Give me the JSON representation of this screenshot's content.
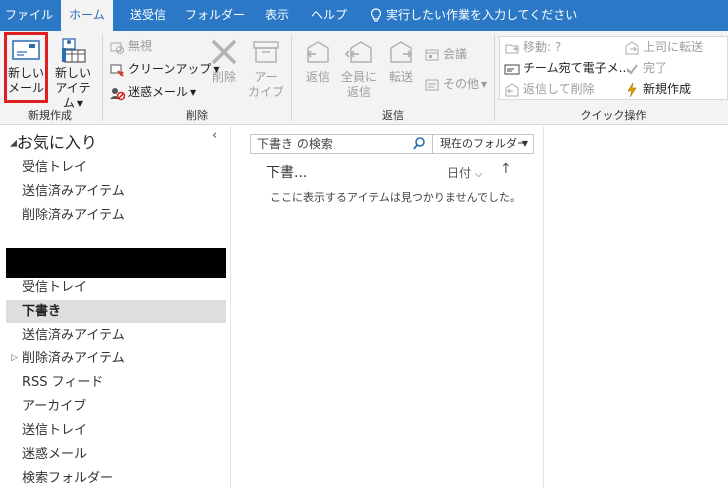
{
  "menubar": {
    "tabs": [
      "ファイル",
      "ホーム",
      "送受信",
      "フォルダー",
      "表示",
      "ヘルプ"
    ],
    "tell_me": "実行したい作業を入力してください"
  },
  "ribbon": {
    "new_group": {
      "label": "新規作成",
      "new_mail_line1": "新しい",
      "new_mail_line2": "メール",
      "new_items_line1": "新しい",
      "new_items_line2": "アイテム"
    },
    "delete_group": {
      "label": "削除",
      "ignore": "無視",
      "cleanup": "クリーンアップ",
      "junk": "迷惑メール",
      "delete": "削除",
      "archive_line1": "アー",
      "archive_line2": "カイブ"
    },
    "respond_group": {
      "label": "返信",
      "reply": "返信",
      "reply_all_line1": "全員に",
      "reply_all_line2": "返信",
      "forward": "転送",
      "meeting": "会議",
      "more": "その他"
    },
    "quicksteps_group": {
      "label": "クイック操作",
      "move_to": "移動: ?",
      "team_email": "チーム宛て電子メ...",
      "reply_delete": "返信して削除",
      "to_manager": "上司に転送",
      "done": "完了",
      "create_new": "新規作成"
    }
  },
  "folderpane": {
    "favorites_header": "お気に入り",
    "favorites": [
      "受信トレイ",
      "送信済みアイテム",
      "削除済みアイテム"
    ],
    "folders": [
      "受信トレイ",
      "下書き",
      "送信済みアイテム",
      "削除済みアイテム",
      "RSS フィード",
      "アーカイブ",
      "送信トレイ",
      "迷惑メール",
      "検索フォルダー"
    ]
  },
  "msglist": {
    "search_placeholder": "下書き の検索",
    "scope": "現在のフォルダー",
    "title": "下書...",
    "sort_by": "日付",
    "empty_message": "ここに表示するアイテムは見つかりませんでした。"
  },
  "colors": {
    "accent": "#2b78c6",
    "ribbon_bg": "#f3f3f3",
    "highlight_red": "#e02020",
    "disabled_text": "#9d9d9d",
    "selected_folder": "#dedede"
  }
}
